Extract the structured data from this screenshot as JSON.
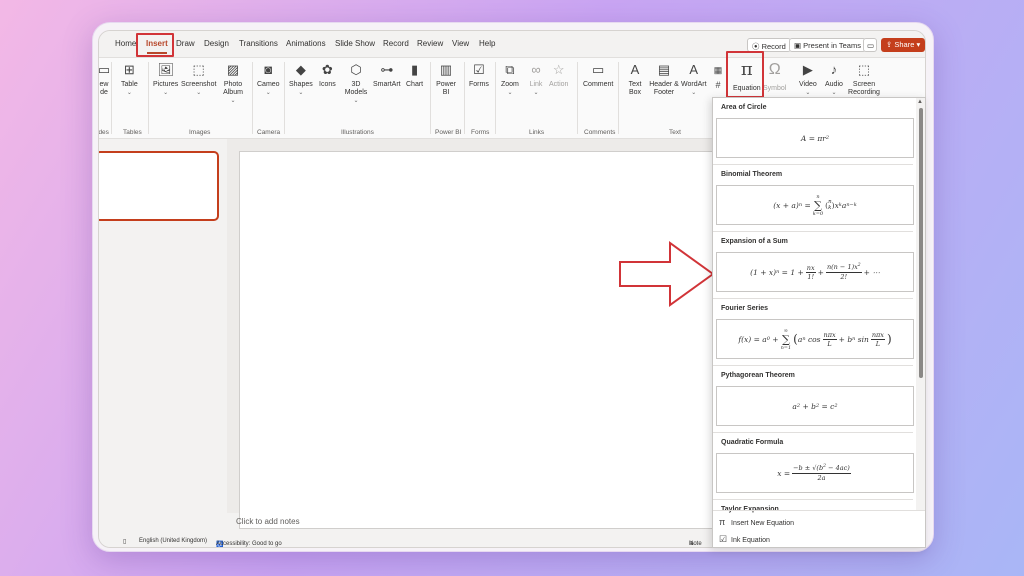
{
  "tabs": [
    "Home",
    "Insert",
    "Draw",
    "Design",
    "Transitions",
    "Animations",
    "Slide Show",
    "Record",
    "Review",
    "View",
    "Help"
  ],
  "active_tab": "Insert",
  "top_buttons": {
    "record": "Record",
    "present": "Present in Teams",
    "share": "Share"
  },
  "ribbon": {
    "new_slide": [
      "ew",
      "de"
    ],
    "table": "Table",
    "pictures": "Pictures",
    "screenshot": "Screenshot",
    "photo_album": "Photo Album",
    "cameo": "Cameo",
    "shapes": "Shapes",
    "icons": "Icons",
    "models_3d": "3D Models",
    "smartart": "SmartArt",
    "chart": "Chart",
    "power_bi": "Power BI",
    "forms": "Forms",
    "zoom": "Zoom",
    "link": "Link",
    "action": "Action",
    "comment": "Comment",
    "text_box": "Text Box",
    "header_footer": "Header & Footer",
    "wordart": "WordArt",
    "equation": "Equation",
    "symbol": "Symbol",
    "video": "Video",
    "audio": "Audio",
    "screen_recording": "Screen Recording",
    "groups": [
      "ides",
      "Tables",
      "Images",
      "Camera",
      "Illustrations",
      "Power BI",
      "Forms",
      "Links",
      "Comments",
      "Text"
    ]
  },
  "notes_placeholder": "Click to add notes",
  "status": {
    "language": "English (United Kingdom)",
    "accessibility": "Accessibility: Good to go",
    "notes": "Note"
  },
  "equations": [
    {
      "name": "Area of Circle"
    },
    {
      "name": "Binomial Theorem"
    },
    {
      "name": "Expansion of a Sum"
    },
    {
      "name": "Fourier Series"
    },
    {
      "name": "Pythagorean Theorem"
    },
    {
      "name": "Quadratic Formula"
    },
    {
      "name": "Taylor Expansion"
    }
  ],
  "menu": {
    "insert_new": "Insert New Equation",
    "ink": "Ink Equation"
  },
  "colors": {
    "accent": "#b7472a",
    "highlight": "#d13438",
    "share": "#c43e1c"
  }
}
